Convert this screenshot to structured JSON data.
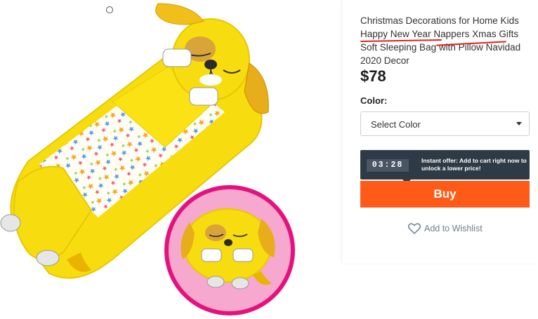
{
  "product": {
    "title": "Christmas Decorations for Home Kids Happy New Year Nappers Xmas Gifts Soft Sleeping Bag with Pillow Navidad 2020 Decor",
    "title_lines": [
      "Christmas Decorations for Home Kids",
      "Happy New Year Nappers Xmas Gifts",
      "Soft Sleeping Bag with Pillow Navidad",
      "2020 Decor"
    ],
    "price": "$78"
  },
  "options": {
    "color_label": "Color:",
    "select_placeholder": "Select Color"
  },
  "offer": {
    "timer": "03:28",
    "text": "Instant offer: Add to cart right now to unlock a lower price!"
  },
  "actions": {
    "buy_label": "Buy",
    "wishlist_label": "Add to Wishlist"
  },
  "colors": {
    "accent": "#ff5b18",
    "offer_bg": "#2e3a45",
    "underline": "#e0201c",
    "product_yellow": "#f7dc10",
    "circle_border": "#e5127d",
    "circle_bg": "#f6a8cf"
  },
  "icons": {
    "wishlist": "heart-outline-icon",
    "select": "chevron-down-icon"
  }
}
